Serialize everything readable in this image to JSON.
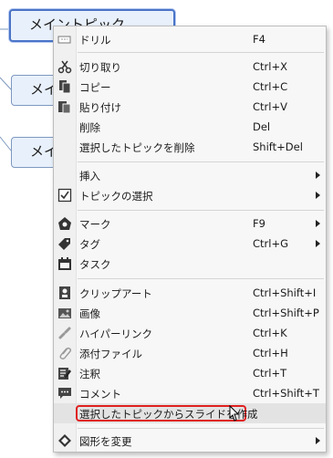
{
  "topics": {
    "main_selected": "メイントピック",
    "topic_2": "メイ",
    "topic_3": "メイ"
  },
  "menu": {
    "items": [
      {
        "label": "ドリル",
        "shortcut": "F4",
        "icon": "drill-icon"
      },
      {
        "label": "切り取り",
        "shortcut": "Ctrl+X",
        "icon": "scissors-icon"
      },
      {
        "label": "コピー",
        "shortcut": "Ctrl+C",
        "icon": "copy-icon"
      },
      {
        "label": "貼り付け",
        "shortcut": "Ctrl+V",
        "icon": "paste-icon"
      },
      {
        "label": "削除",
        "shortcut": "Del",
        "icon": ""
      },
      {
        "label": "選択したトピックを削除",
        "shortcut": "Shift+Del",
        "icon": ""
      },
      {
        "label": "挿入",
        "shortcut": "",
        "icon": "",
        "submenu": true
      },
      {
        "label": "トピックの選択",
        "shortcut": "",
        "icon": "checkbox-icon",
        "submenu": true
      },
      {
        "label": "マーク",
        "shortcut": "F9",
        "icon": "mark-icon",
        "submenu": true
      },
      {
        "label": "タグ",
        "shortcut": "Ctrl+G",
        "icon": "tag-icon",
        "submenu": true
      },
      {
        "label": "タスク",
        "shortcut": "",
        "icon": "task-icon"
      },
      {
        "label": "クリップアート",
        "shortcut": "Ctrl+Shift+I",
        "icon": "clipart-icon"
      },
      {
        "label": "画像",
        "shortcut": "Ctrl+Shift+P",
        "icon": "image-icon"
      },
      {
        "label": "ハイパーリンク",
        "shortcut": "Ctrl+K",
        "icon": "link-icon"
      },
      {
        "label": "添付ファイル",
        "shortcut": "Ctrl+H",
        "icon": "paperclip-icon"
      },
      {
        "label": "注釈",
        "shortcut": "Ctrl+T",
        "icon": "note-icon"
      },
      {
        "label": "コメント",
        "shortcut": "Ctrl+Shift+T",
        "icon": "comment-icon"
      },
      {
        "label": "選択したトピックからスライドを作成",
        "shortcut": "",
        "icon": ""
      },
      {
        "label": "図形を変更",
        "shortcut": "",
        "icon": "shape-icon",
        "submenu": true
      }
    ]
  },
  "colors": {
    "highlight_border": "#e02020",
    "topic_fill": "#e8f0fb",
    "selected_border": "#4a74c9"
  }
}
